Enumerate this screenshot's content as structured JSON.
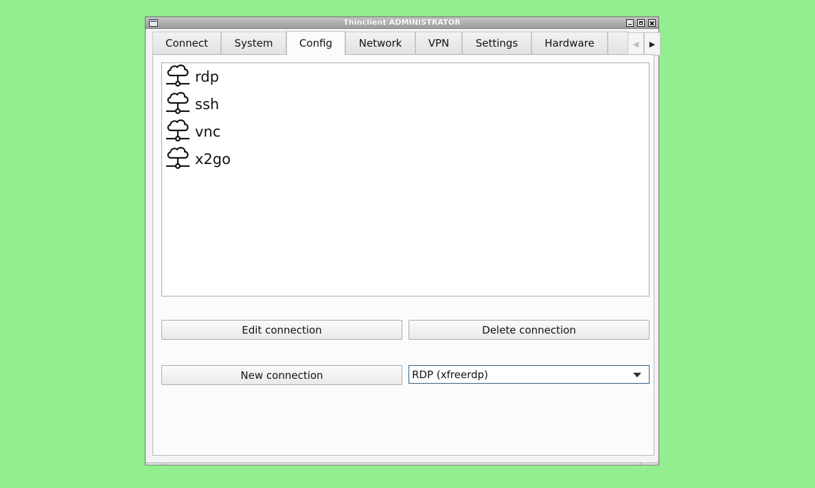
{
  "window": {
    "title": "Thinclient ADMINISTRATOR"
  },
  "tabs": [
    {
      "label": "Connect"
    },
    {
      "label": "System"
    },
    {
      "label": "Config"
    },
    {
      "label": "Network"
    },
    {
      "label": "VPN"
    },
    {
      "label": "Settings"
    },
    {
      "label": "Hardware"
    }
  ],
  "active_tab": "Config",
  "connections": [
    {
      "name": "rdp",
      "icon": "cloud-network-icon"
    },
    {
      "name": "ssh",
      "icon": "cloud-network-icon"
    },
    {
      "name": "vnc",
      "icon": "cloud-network-icon"
    },
    {
      "name": "x2go",
      "icon": "cloud-network-icon"
    }
  ],
  "buttons": {
    "edit": "Edit connection",
    "delete": "Delete connection",
    "new": "New connection"
  },
  "connection_type": {
    "selected": "RDP (xfreerdp)"
  },
  "colors": {
    "desktop": "#93ee8f",
    "combo_focus": "#2b5d85"
  }
}
